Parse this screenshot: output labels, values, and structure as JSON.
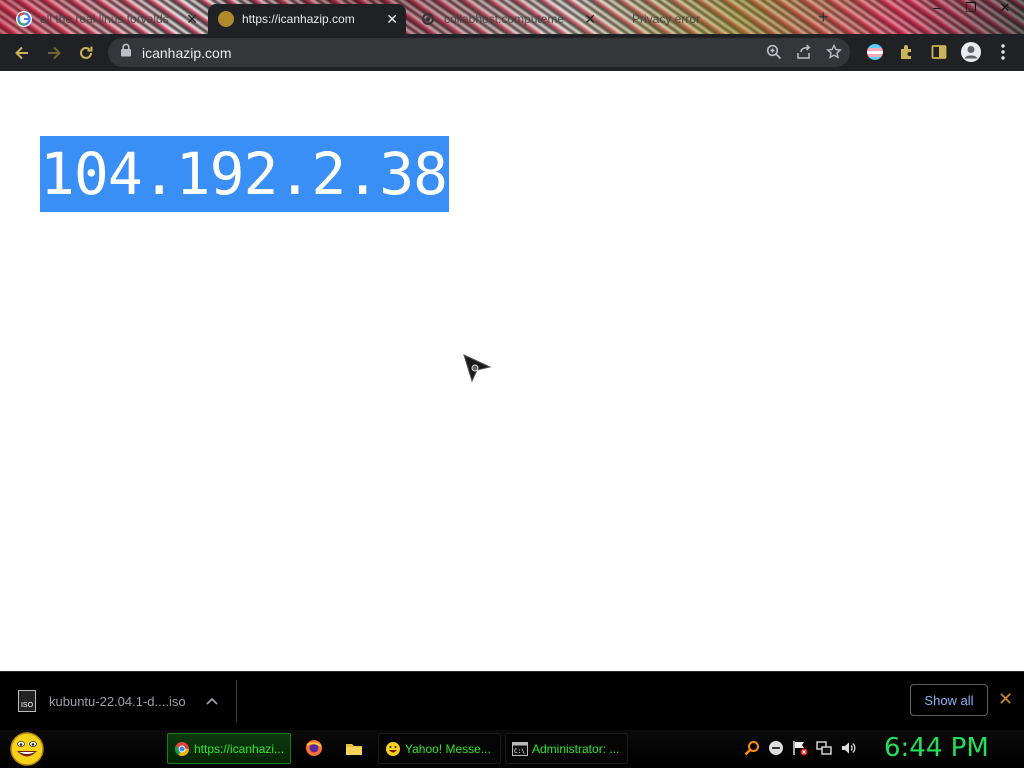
{
  "browser": {
    "tabs": [
      {
        "title": "all the real linus torvalds",
        "favicon": "google-icon",
        "active": false
      },
      {
        "title": "https://icanhazip.com",
        "favicon": "globe-icon",
        "active": true
      },
      {
        "title": "collabhost.computeme",
        "favicon": "gear-icon",
        "active": false
      },
      {
        "title": "Privacy error",
        "favicon": "warning-icon",
        "active": false
      }
    ],
    "window_controls": {
      "minimize": "–",
      "maximize": "❐",
      "close": "✕"
    },
    "new_tab_symbol": "+",
    "address": "icanhazip.com"
  },
  "page": {
    "ip_address": "104.192.2.38",
    "selection_color": "#3a8ff6"
  },
  "downloads": {
    "file_badge": "ISO",
    "file_name": "kubuntu-22.04.1-d....iso",
    "show_all_label": "Show all",
    "close_symbol": "✕"
  },
  "taskbar": {
    "buttons": [
      {
        "label": "https://icanhazi...",
        "icon": "chrome-icon",
        "active": true
      },
      {
        "label": "Yahoo! Messe...",
        "icon": "smiley-icon",
        "active": false
      },
      {
        "label": "Administrator: ...",
        "icon": "terminal-icon",
        "active": false
      }
    ],
    "clock": "6:44 PM",
    "text_color": "#2ee62e"
  }
}
